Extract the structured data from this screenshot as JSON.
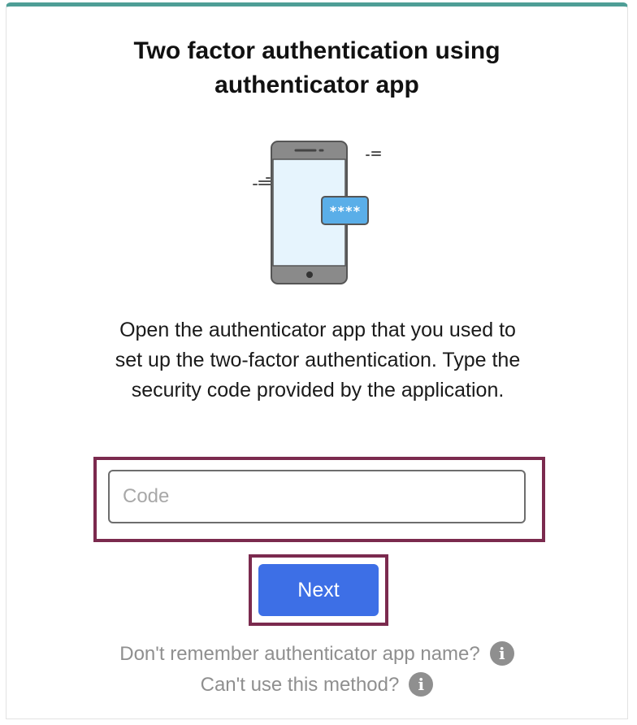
{
  "accent_colors": {
    "top_bar": "#4e9e96",
    "primary_button": "#3d6fe6",
    "highlight_frame": "#7b2a4e",
    "screen": "#e6f4fd",
    "code_bubble": "#5aaee8"
  },
  "page": {
    "title_line1": "Two factor authentication using",
    "title_line2": "authenticator app",
    "description_line1": "Open the authenticator app that you used to",
    "description_line2": "set up the two-factor authentication. Type the",
    "description_line3": "security code provided by the application."
  },
  "illustration": {
    "icon": "phone-with-code-illustration",
    "bubble_text": "****"
  },
  "form": {
    "code_placeholder": "Code",
    "code_value": "",
    "next_label": "Next"
  },
  "help": {
    "app_name_link": "Don't remember authenticator app name?",
    "other_method_link": "Can't use this method?",
    "info_icon_glyph": "i"
  }
}
